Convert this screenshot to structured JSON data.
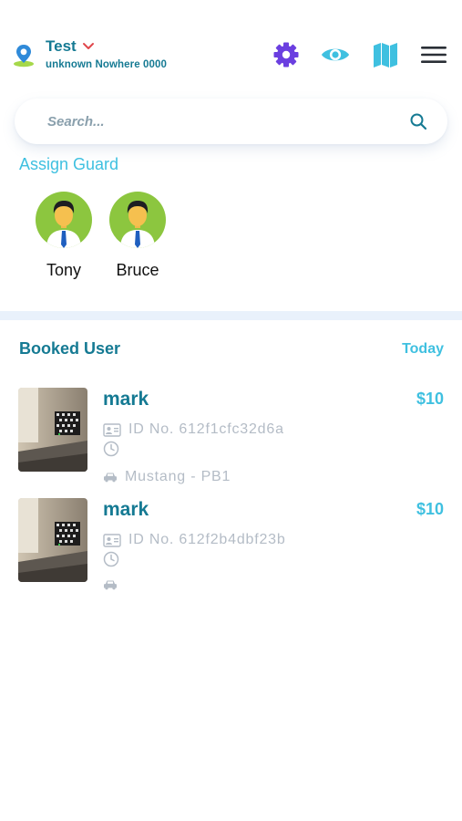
{
  "header": {
    "location_title": "Test",
    "location_subtitle": "unknown Nowhere 0000",
    "icons": [
      "location-pin-icon",
      "chevron-down-icon",
      "gear-icon",
      "eye-icon",
      "map-icon",
      "hamburger-menu-icon"
    ],
    "colors": {
      "brand": "#157a93",
      "accent": "#3fc0e0",
      "gear": "#6b3fe0",
      "chevron": "#e0474c"
    }
  },
  "search": {
    "placeholder": "Search..."
  },
  "assign_guard": {
    "title": "Assign Guard",
    "guards": [
      {
        "name": "Tony"
      },
      {
        "name": "Bruce"
      }
    ]
  },
  "booked": {
    "title": "Booked User",
    "filter": "Today",
    "items": [
      {
        "name": "mark",
        "price": "$10",
        "id_text": "ID No. 612f1cfc32d6a",
        "time": "",
        "vehicle": "Mustang - PB1"
      },
      {
        "name": "mark",
        "price": "$10",
        "id_text": "ID No. 612f2b4dbf23b",
        "time": "",
        "vehicle": ""
      }
    ]
  }
}
